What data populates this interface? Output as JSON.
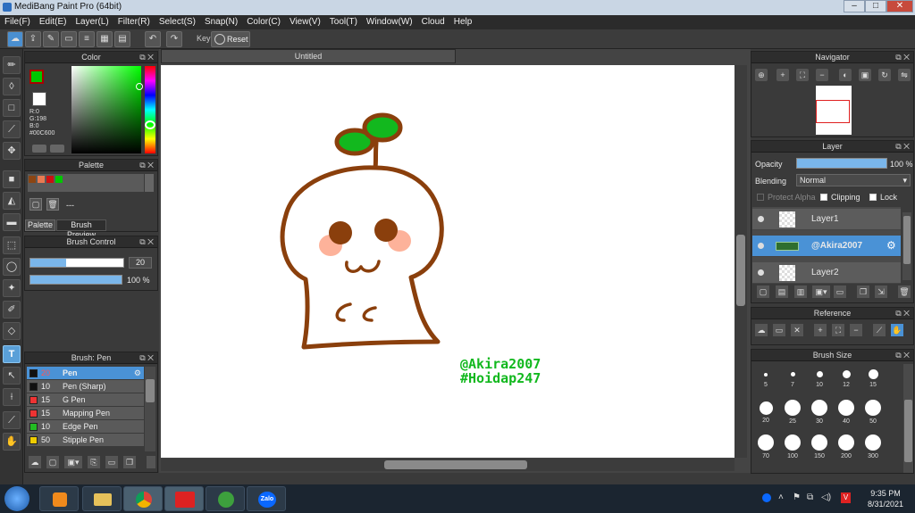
{
  "app": {
    "title": "MediBang Paint Pro (64bit)"
  },
  "menu": [
    "File(F)",
    "Edit(E)",
    "Layer(L)",
    "Filter(R)",
    "Select(S)",
    "Snap(N)",
    "Color(C)",
    "View(V)",
    "Tool(T)",
    "Window(W)",
    "Cloud",
    "Help"
  ],
  "toolbar": {
    "key_label": "Key",
    "reset_label": "Reset"
  },
  "document": {
    "tab_title": "Untitled"
  },
  "color_panel": {
    "title": "Color",
    "r": "R:0",
    "g": "G:198",
    "b": "B:0",
    "hex": "#00C600",
    "primary": "#00c600",
    "secondary": "#ffffff"
  },
  "palette_panel": {
    "title": "Palette",
    "swatches": [
      "#8b4513",
      "#e87b52",
      "#cc1111",
      "#00c600"
    ],
    "tabs": [
      "Palette",
      "Brush Preview"
    ],
    "empty_label": "---"
  },
  "brush_control": {
    "title": "Brush Control",
    "size": "20",
    "opacity": "100 %"
  },
  "brush_list": {
    "title": "Brush: Pen",
    "items": [
      {
        "size": "20",
        "name": "Pen",
        "color": "#111111"
      },
      {
        "size": "10",
        "name": "Pen (Sharp)",
        "color": "#111111"
      },
      {
        "size": "15",
        "name": "G Pen",
        "color": "#ee3333"
      },
      {
        "size": "15",
        "name": "Mapping Pen",
        "color": "#ee3333"
      },
      {
        "size": "10",
        "name": "Edge Pen",
        "color": "#22bb22"
      },
      {
        "size": "50",
        "name": "Stipple Pen",
        "color": "#eecc00"
      }
    ]
  },
  "navigator": {
    "title": "Navigator"
  },
  "layer_panel": {
    "title": "Layer",
    "opacity_label": "Opacity",
    "opacity_value": "100 %",
    "blending_label": "Blending",
    "blending_value": "Normal",
    "protect_alpha": "Protect Alpha",
    "clipping": "Clipping",
    "lock": "Lock",
    "layers": [
      "Layer1",
      "@Akira2007",
      "Layer2"
    ]
  },
  "reference_panel": {
    "title": "Reference"
  },
  "brush_size_panel": {
    "title": "Brush Size",
    "sizes": [
      "5",
      "7",
      "10",
      "12",
      "15",
      "20",
      "25",
      "30",
      "40",
      "50",
      "70",
      "100",
      "150",
      "200",
      "300"
    ]
  },
  "canvas_text": {
    "line1": "@Akira2007",
    "line2": "#Hoidap247"
  },
  "taskbar": {
    "time": "9:35 PM",
    "date": "8/31/2021",
    "zalo": "Zalo"
  }
}
